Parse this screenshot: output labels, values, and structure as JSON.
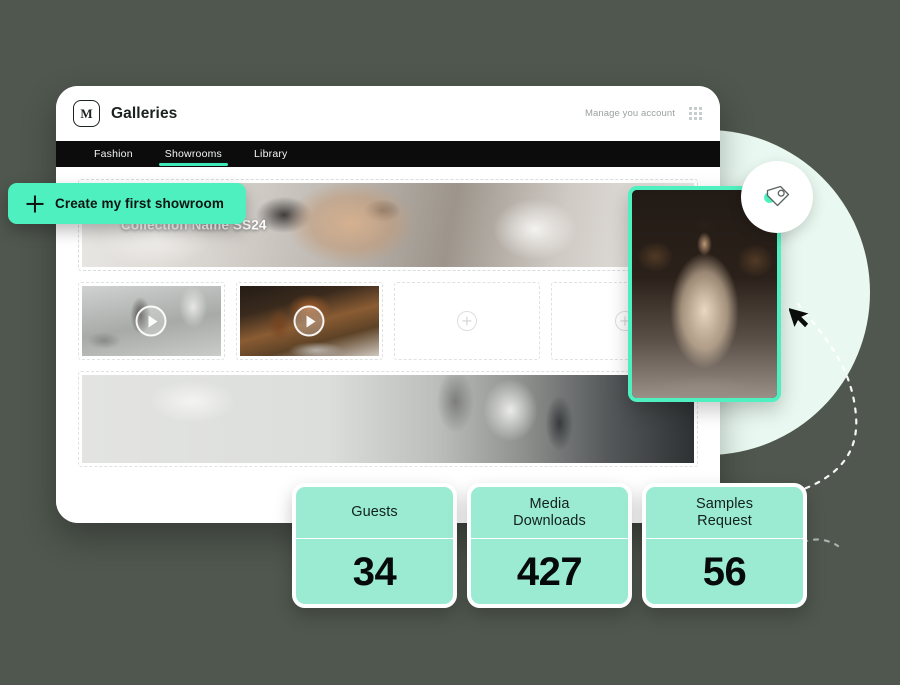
{
  "background": {
    "page_color": "#4f574e",
    "accent_color": "#4ff0bf",
    "mint_circle_color": "#e9f8f1"
  },
  "app_window": {
    "header": {
      "logo_letter": "M",
      "logo_name": "app-logo",
      "title": "Galleries",
      "manage_account_label": "Manage you account",
      "grid_icon_name": "apps-grid-icon"
    },
    "tabs": [
      {
        "label": "Fashion",
        "active": false
      },
      {
        "label": "Showrooms",
        "active": true
      },
      {
        "label": "Library",
        "active": false
      }
    ],
    "hero": {
      "caption": "Collection Name SS24"
    },
    "thumbnails": [
      {
        "type": "video",
        "has_play_button": true
      },
      {
        "type": "video",
        "has_play_button": true
      },
      {
        "type": "empty",
        "add_icon": "plus-icon"
      },
      {
        "type": "empty",
        "add_icon": "plus-icon"
      }
    ],
    "wide_photo": {
      "type": "image"
    }
  },
  "create_button": {
    "label": "Create my first showroom",
    "icon": "plus-icon",
    "color": "#4ff0bf"
  },
  "featured_card": {
    "border_color": "#4ff0bf",
    "type": "runway-photo"
  },
  "tag_badge": {
    "icon": "tag-icon"
  },
  "cursor": {
    "icon": "arrow-cursor",
    "path": "dashed-curve"
  },
  "stats": [
    {
      "label": "Guests",
      "value": "34"
    },
    {
      "label": "Media\nDownloads",
      "value": "427"
    },
    {
      "label": "Samples\nRequest",
      "value": "56"
    }
  ],
  "stat_card_color": "#9aebd2"
}
